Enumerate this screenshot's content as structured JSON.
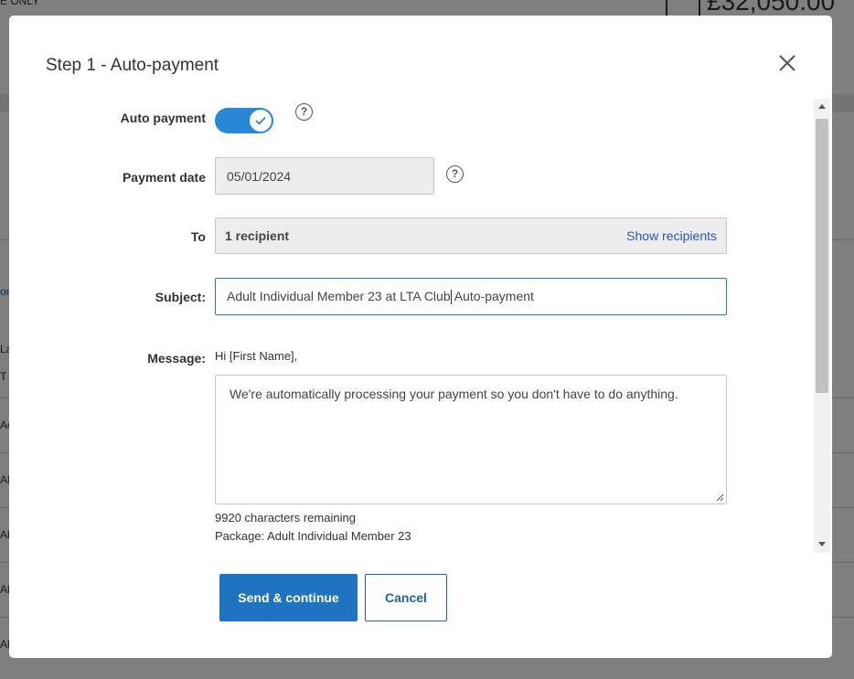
{
  "background": {
    "top_left_text": "E ONLY",
    "amount": "£32,050.00",
    "side_link": "or",
    "side_rows": [
      "La",
      "T",
      "Ac",
      "Al",
      "Al",
      "Al",
      "Al"
    ]
  },
  "modal": {
    "title": "Step 1 - Auto-payment",
    "fields": {
      "auto_payment_label": "Auto payment",
      "auto_payment_on": true,
      "payment_date_label": "Payment date",
      "payment_date_value": "05/01/2024",
      "to_label": "To",
      "to_value": "1 recipient",
      "show_recipients_label": "Show recipients",
      "subject_label": "Subject:",
      "subject_value_before_cursor": "Adult Individual Member 23 at LTA Club",
      "subject_value_after_cursor": " Auto-payment",
      "message_label": "Message:",
      "message_greeting": "Hi [First Name],",
      "message_body": "We're automatically processing your payment so you don't have to do anything.",
      "characters_remaining": "9920 characters remaining",
      "package_line": "Package: Adult Individual Member 23"
    },
    "buttons": {
      "send_continue": "Send & continue",
      "cancel": "Cancel"
    },
    "help_symbol": "?"
  },
  "colors": {
    "accent": "#1e74c0",
    "toggle_on": "#2787d6",
    "link": "#2a55b8",
    "overlay": "rgba(0,0,0,0.5)"
  },
  "icons": {
    "close": "close-icon",
    "help": "question-circle-icon",
    "check": "check-icon",
    "resize": "resize-grip-icon"
  }
}
